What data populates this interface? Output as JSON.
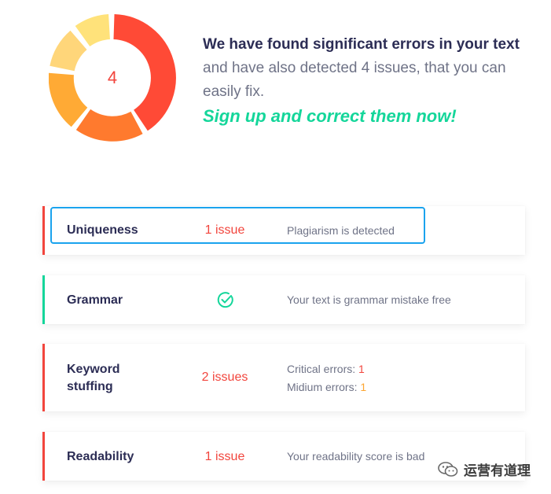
{
  "summary": {
    "issue_count": "4",
    "headline_bold": "We have found significant errors in your text",
    "headline_regular": "and have also detected 4 issues, that you can easily fix.",
    "cta": "Sign up and correct them now!"
  },
  "donut_colors": [
    "#ff4a36",
    "#ff7a2e",
    "#ffaa35",
    "#ffd67a",
    "#ffe27a"
  ],
  "checks": [
    {
      "name": "Uniqueness",
      "status": "1 issue",
      "description": "Plagiarism is detected",
      "state": "error"
    },
    {
      "name": "Grammar",
      "status": "",
      "description": "Your text is grammar mistake free",
      "state": "ok",
      "icon": "check-circle-icon"
    },
    {
      "name_line1": "Keyword",
      "name_line2": "stuffing",
      "status": "2 issues",
      "critical_label": "Critical errors:",
      "critical_value": "1",
      "medium_label": "Midium errors:",
      "medium_value": "1",
      "state": "error"
    },
    {
      "name": "Readability",
      "status": "1 issue",
      "description": "Your readability score is bad",
      "state": "error"
    }
  ],
  "watermark": {
    "text": "运营有道理",
    "icon": "wechat-icon"
  },
  "colors": {
    "error": "#f2453d",
    "ok": "#14d69a",
    "highlight": "#1aa3ee",
    "orange": "#fda530"
  }
}
